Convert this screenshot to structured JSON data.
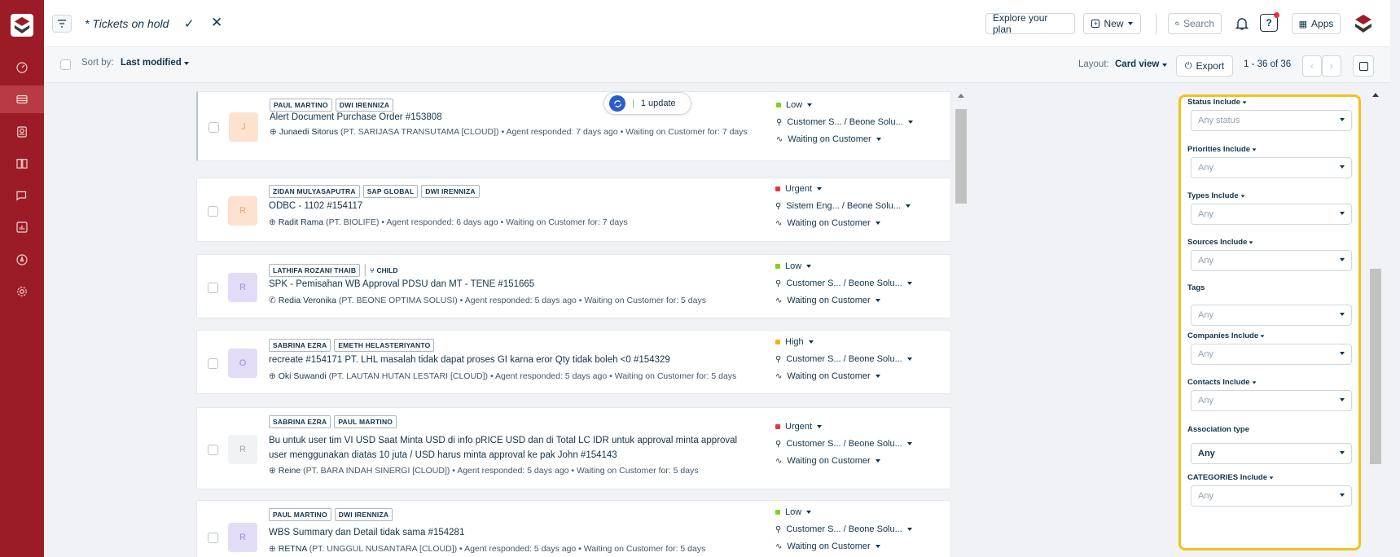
{
  "topbar": {
    "view_title": "* Tickets on hold",
    "explore_label": "Explore your plan",
    "new_label": "New",
    "search_label": "Search",
    "apps_label": "Apps"
  },
  "subbar": {
    "sort_by_label": "Sort by:",
    "sort_by_value": "Last modified",
    "layout_label": "Layout:",
    "layout_value": "Card view",
    "export_label": "Export",
    "pagination": "1 - 36 of 36"
  },
  "update_pill": {
    "count_label": "1 update"
  },
  "tickets": [
    {
      "avatar": "J",
      "avatar_bg": "#fde2cf",
      "avatar_fg": "#e8a880",
      "tags": [
        "PAUL MARTINO",
        "DWI IRENNIZA"
      ],
      "child": false,
      "subject": "Alert Document Purchase Order #153808",
      "contact": "Junaedi Sitorus",
      "company": "(PT. SARIJASA TRANSUTAMA [CLOUD])",
      "meta": "Agent responded: 7 days ago • Waiting on Customer for: 7 days",
      "priority": "Low",
      "priority_color": "#7ed321",
      "group": "Customer S... / Beone Solu...",
      "status": "Waiting on Customer"
    },
    {
      "avatar": "R",
      "avatar_bg": "#fde2cf",
      "avatar_fg": "#e8a880",
      "tags": [
        "ZIDAN MULYASAPUTRA",
        "SAP GLOBAL",
        "DWI IRENNIZA"
      ],
      "child": false,
      "subject": "ODBC - 1102 #154117",
      "contact": "Radit Rama",
      "company": "(PT. BIOLIFE)",
      "meta": "Agent responded: 6 days ago • Waiting on Customer for: 7 days",
      "priority": "Urgent",
      "priority_color": "#e43538",
      "group": "Sistem Eng... / Beone Solu...",
      "status": "Waiting on Customer"
    },
    {
      "avatar": "R",
      "avatar_bg": "#e2dcf7",
      "avatar_fg": "#9d8fd1",
      "tags": [
        "LATHIFA ROZANI THAIB"
      ],
      "child": true,
      "child_label": "CHILD",
      "subject": "SPK - Pemisahan WB Approval PDSU dan MT - TENE #151665",
      "contact": "Redia Veronika",
      "company": "(PT. BEONE OPTIMA SOLUSI)",
      "meta": "Agent responded: 5 days ago • Waiting on Customer for: 5 days",
      "priority": "Low",
      "priority_color": "#7ed321",
      "group": "Customer S... / Beone Solu...",
      "status": "Waiting on Customer"
    },
    {
      "avatar": "O",
      "avatar_bg": "#e2dcf7",
      "avatar_fg": "#9d8fd1",
      "tags": [
        "SABRINA EZRA",
        "EMETH HELASTERIYANTO"
      ],
      "child": false,
      "subject": "recreate #154171 PT. LHL masalah tidak dapat proses GI karna eror Qty tidak boleh <0 #154329",
      "contact": "Oki Suwandi",
      "company": "(PT. LAUTAN HUTAN LESTARI [CLOUD])",
      "meta": "Agent responded: 5 days ago • Waiting on Customer for: 5 days",
      "priority": "High",
      "priority_color": "#f5b400",
      "group": "Customer S... / Beone Solu...",
      "status": "Waiting on Customer"
    },
    {
      "avatar": "R",
      "avatar_bg": "#f1f2f4",
      "avatar_fg": "#a0a8b0",
      "tags": [
        "SABRINA EZRA",
        "PAUL MARTINO"
      ],
      "child": false,
      "subject": "Bu untuk user tim VI USD Saat Minta USD di info pRICE USD dan di Total LC IDR untuk approval minta approval user menggunakan diatas 10 juta / USD harus minta approval ke pak John #154143",
      "contact": "Reine",
      "company": "(PT. BARA INDAH SINERGI [CLOUD])",
      "meta": "Agent responded: 5 days ago • Waiting on Customer for: 5 days",
      "priority": "Urgent",
      "priority_color": "#e43538",
      "group": "Customer S... / Beone Solu...",
      "status": "Waiting on Customer"
    },
    {
      "avatar": "R",
      "avatar_bg": "#e2dcf7",
      "avatar_fg": "#9d8fd1",
      "tags": [
        "PAUL MARTINO",
        "DWI IRENNIZA"
      ],
      "child": false,
      "subject": "WBS Summary dan Detail tidak sama #154281",
      "contact": "RETNA",
      "company": "(PT. UNGGUL NUSANTARA [CLOUD])",
      "meta": "Agent responded: 5 days ago • Waiting on Customer for: 5 days",
      "priority": "Low",
      "priority_color": "#7ed321",
      "group": "Customer S... / Beone Solu...",
      "status": "Waiting on Customer"
    }
  ],
  "filters": [
    {
      "label": "Status Include",
      "dropdown": true,
      "value": "Any status",
      "dark": false
    },
    {
      "label": "Priorities Include",
      "dropdown": true,
      "value": "Any",
      "dark": false
    },
    {
      "label": "Types Include",
      "dropdown": true,
      "value": "Any",
      "dark": false
    },
    {
      "label": "Sources Include",
      "dropdown": true,
      "value": "Any",
      "dark": false
    },
    {
      "label": "Tags",
      "dropdown": false,
      "value": "Any",
      "dark": false
    },
    {
      "label": "Companies Include",
      "dropdown": true,
      "value": "Any",
      "dark": false
    },
    {
      "label": "Contacts Include",
      "dropdown": true,
      "value": "Any",
      "dark": false
    },
    {
      "label": "Association type",
      "dropdown": false,
      "value": "Any",
      "dark": true
    },
    {
      "label": "CATEGORIES Include",
      "dropdown": true,
      "value": "Any",
      "dark": false
    }
  ],
  "colors": {
    "brand_rail": "#9b1c26",
    "highlight_border": "#f2c21c",
    "accent_blue": "#2c5cc5"
  }
}
